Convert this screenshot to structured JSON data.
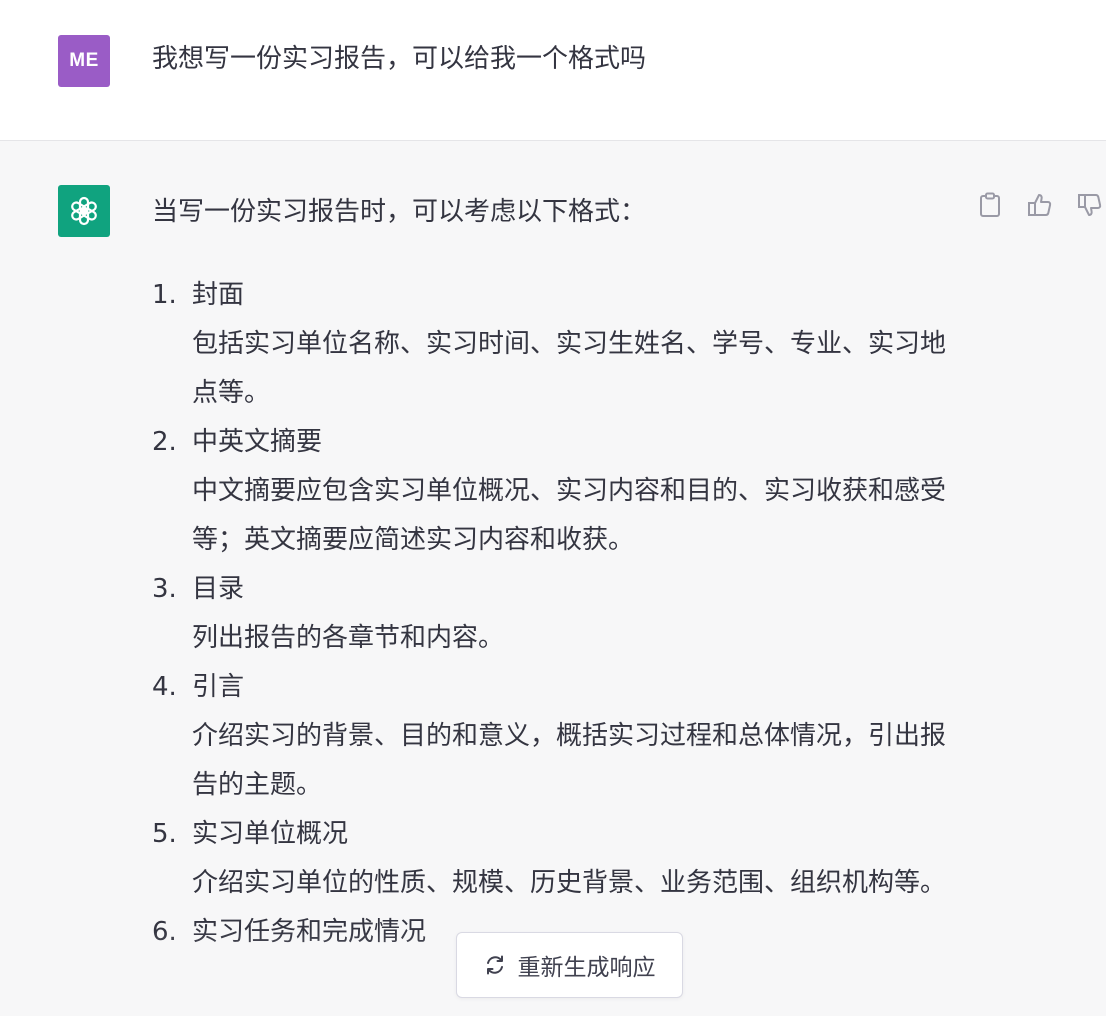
{
  "user_message": {
    "avatar_initials": "ME",
    "text": "我想写一份实习报告，可以给我一个格式吗"
  },
  "assistant_message": {
    "avatar_icon": "openai-logo-icon",
    "intro": "当写一份实习报告时，可以考虑以下格式：",
    "actions": [
      {
        "name": "copy-icon"
      },
      {
        "name": "thumbs-up-icon"
      },
      {
        "name": "thumbs-down-icon"
      }
    ],
    "items": [
      {
        "num": "1.",
        "title": "封面",
        "desc": "包括实习单位名称、实习时间、实习生姓名、学号、专业、实习地点等。"
      },
      {
        "num": "2.",
        "title": "中英文摘要",
        "desc": "中文摘要应包含实习单位概况、实习内容和目的、实习收获和感受等；英文摘要应简述实习内容和收获。"
      },
      {
        "num": "3.",
        "title": "目录",
        "desc": "列出报告的各章节和内容。"
      },
      {
        "num": "4.",
        "title": "引言",
        "desc": "介绍实习的背景、目的和意义，概括实习过程和总体情况，引出报告的主题。"
      },
      {
        "num": "5.",
        "title": "实习单位概况",
        "desc": "介绍实习单位的性质、规模、历史背景、业务范围、组织机构等。"
      },
      {
        "num": "6.",
        "title": "实习任务和完成情况",
        "desc": ""
      }
    ]
  },
  "regenerate_button": {
    "icon": "refresh-icon",
    "label": "重新生成响应"
  },
  "colors": {
    "user_avatar": "#9a5cc6",
    "assistant_avatar": "#10a37f",
    "assistant_bg": "#f7f7f8"
  }
}
